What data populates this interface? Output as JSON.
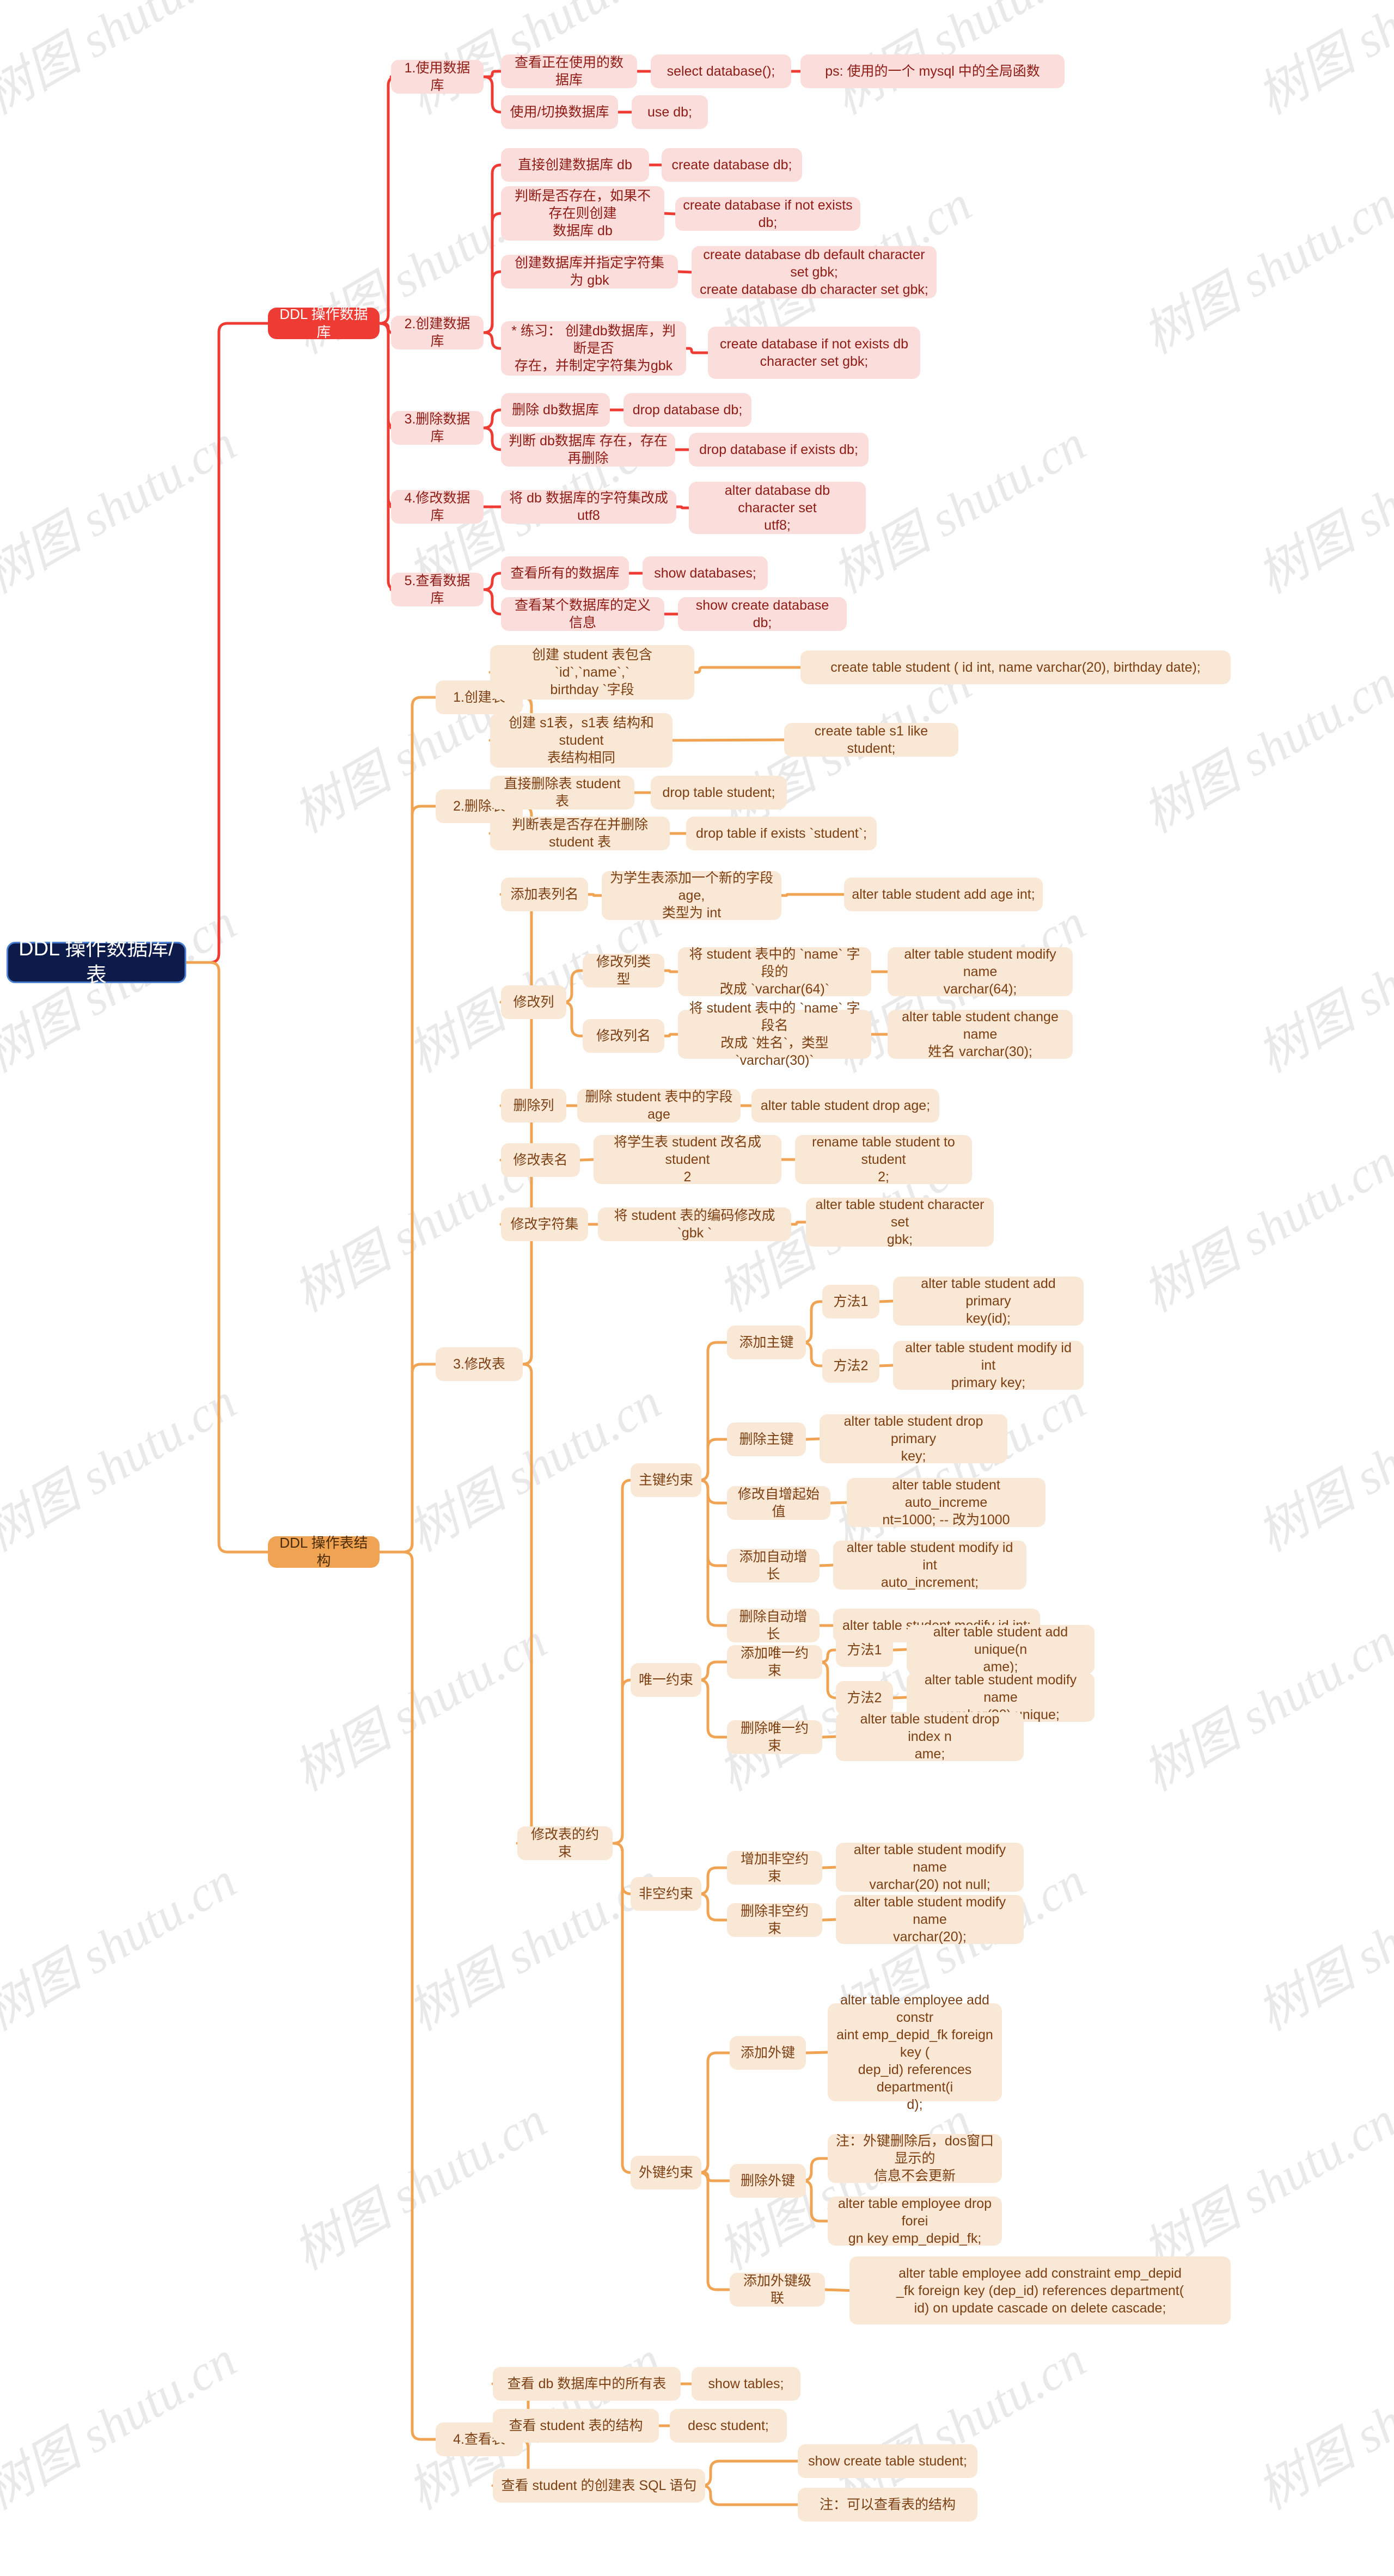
{
  "watermarks": [
    "树图 shutu.cn"
  ],
  "colors": {
    "root_bg": "#0d1b4b",
    "root_border": "#4a7fd4",
    "branch_db": "#ee3b33",
    "branch_table": "#f0a352",
    "node_db_bg": "#fbdedc",
    "node_db_text": "#8e1b14",
    "node_table_bg": "#fae8d7",
    "node_table_text": "#7c3f12"
  },
  "root": {
    "label": "DDL 操作数据库/表"
  },
  "branches": [
    {
      "id": "db",
      "label": "DDL 操作数据库"
    },
    {
      "id": "table",
      "label": "DDL 操作表结构"
    }
  ],
  "db_section": {
    "groups": [
      {
        "label": "1.使用数据库",
        "items": [
          {
            "label": "查看正在使用的数据库",
            "sql": "select database();",
            "note": "ps: 使用的一个 mysql 中的全局函数"
          },
          {
            "label": "使用/切换数据库",
            "sql": "use db;"
          }
        ]
      },
      {
        "label": "2.创建数据库",
        "items": [
          {
            "label": "直接创建数据库 db",
            "sql": "create database db;"
          },
          {
            "label": "判断是否存在，如果不存在则创建\n数据库 db",
            "sql": "create database if not exists db;"
          },
          {
            "label": "创建数据库并指定字符集为 gbk",
            "sql": "create database db default character set gbk;\ncreate database db character set gbk;"
          },
          {
            "label": "* 练习： 创建db数据库，判断是否\n存在，并制定字符集为gbk",
            "sql": "create database if not exists db\ncharacter set gbk;"
          }
        ]
      },
      {
        "label": "3.删除数据库",
        "items": [
          {
            "label": "删除 db数据库",
            "sql": "drop database db;"
          },
          {
            "label": "判断 db数据库 存在，存在再删除",
            "sql": "drop database if exists db;"
          }
        ]
      },
      {
        "label": "4.修改数据库",
        "items": [
          {
            "label": "将 db 数据库的字符集改成 utf8",
            "sql": "alter database db character set\nutf8;"
          }
        ]
      },
      {
        "label": "5.查看数据库",
        "items": [
          {
            "label": "查看所有的数据库",
            "sql": "show databases;"
          },
          {
            "label": "查看某个数据库的定义信息",
            "sql": "show create database db;"
          }
        ]
      }
    ]
  },
  "table_section": {
    "groups": [
      {
        "label": "1.创建表",
        "items": [
          {
            "label": "创建 student 表包含 `id`,`name`,`\nbirthday `字段",
            "sql": "create table student ( id int, name varchar(20), birthday date);"
          },
          {
            "label": "创建 s1表，s1表 结构和 student\n表结构相同",
            "sql": "create table s1 like student;"
          }
        ]
      },
      {
        "label": "2.删除表",
        "items": [
          {
            "label": "直接删除表 student 表",
            "sql": "drop table student;"
          },
          {
            "label": "判断表是否存在并删除 student 表",
            "sql": "drop table if exists `student`;"
          }
        ]
      },
      {
        "label": "3.修改表",
        "subgroups": [
          {
            "label": "添加表列名",
            "items": [
              {
                "label": "为学生表添加一个新的字段 age,\n类型为 int",
                "sql": "alter table student add age int;"
              }
            ]
          },
          {
            "label": "修改列",
            "children": [
              {
                "label": "修改列类型",
                "items": [
                  {
                    "label": "将 student 表中的 `name` 字段的\n改成 `varchar(64)`",
                    "sql": "alter table student modify name\nvarchar(64);"
                  }
                ]
              },
              {
                "label": "修改列名",
                "items": [
                  {
                    "label": "将 student 表中的 `name` 字段名\n改成 `姓名`，类型 `varchar(30)`",
                    "sql": "alter table student change name\n姓名 varchar(30);"
                  }
                ]
              }
            ]
          },
          {
            "label": "删除列",
            "items": [
              {
                "label": "删除 student 表中的字段 age",
                "sql": "alter table student drop age;"
              }
            ]
          },
          {
            "label": "修改表名",
            "items": [
              {
                "label": "将学生表 student 改名成 student\n2",
                "sql": "rename table student to student\n2;"
              }
            ]
          },
          {
            "label": "修改字符集",
            "items": [
              {
                "label": "将 student 表的编码修改成 `gbk `",
                "sql": "alter table student character set\ngbk;"
              }
            ]
          },
          {
            "label": "修改表的约束",
            "constraints": [
              {
                "label": "主键约束",
                "ops": [
                  {
                    "label": "添加主键",
                    "methods": [
                      {
                        "label": "方法1",
                        "sql": "alter table student add primary\nkey(id);"
                      },
                      {
                        "label": "方法2",
                        "sql": "alter table student modify id int\nprimary key;"
                      }
                    ]
                  },
                  {
                    "label": "删除主键",
                    "sql": "alter table student drop primary\nkey;"
                  },
                  {
                    "label": "修改自增起始值",
                    "sql": "alter table student auto_increme\nnt=1000; -- 改为1000"
                  },
                  {
                    "label": "添加自动增长",
                    "sql": "alter table student modify id int\nauto_increment;"
                  },
                  {
                    "label": "删除自动增长",
                    "sql": "alter table student modify id int;"
                  }
                ]
              },
              {
                "label": "唯一约束",
                "ops": [
                  {
                    "label": "添加唯一约束",
                    "methods": [
                      {
                        "label": "方法1",
                        "sql": "alter table student add unique(n\name);"
                      },
                      {
                        "label": "方法2",
                        "sql": "alter table student modify name\nvarchar(20) unique;"
                      }
                    ]
                  },
                  {
                    "label": "删除唯一约束",
                    "sql": "alter table student drop index n\name;"
                  }
                ]
              },
              {
                "label": "非空约束",
                "ops": [
                  {
                    "label": "增加非空约束",
                    "sql": "alter table student modify name\nvarchar(20) not null;"
                  },
                  {
                    "label": "删除非空约束",
                    "sql": "alter table student modify name\nvarchar(20);"
                  }
                ]
              },
              {
                "label": "外键约束",
                "ops": [
                  {
                    "label": "添加外键",
                    "sql": "alter table employee add constr\naint emp_depid_fk foreign key (\ndep_id) references department(i\nd);"
                  },
                  {
                    "label": "删除外键",
                    "notes": [
                      "注：外键删除后，dos窗口显示的\n信息不会更新",
                      "alter table employee drop forei\ngn key emp_depid_fk;"
                    ]
                  },
                  {
                    "label": "添加外键级联",
                    "sql": "alter table employee add constraint emp_depid\n_fk foreign key (dep_id) references department(\nid) on update cascade on delete cascade;"
                  }
                ]
              }
            ]
          }
        ]
      },
      {
        "label": "4.查看表",
        "items": [
          {
            "label": "查看 db 数据库中的所有表",
            "sql": "show tables;"
          },
          {
            "label": "查看 student 表的结构",
            "sql": "desc student;"
          },
          {
            "label": "查看 student 的创建表 SQL 语句",
            "multi": [
              "show create table student;",
              "注：可以查看表的结构"
            ]
          }
        ]
      }
    ]
  }
}
